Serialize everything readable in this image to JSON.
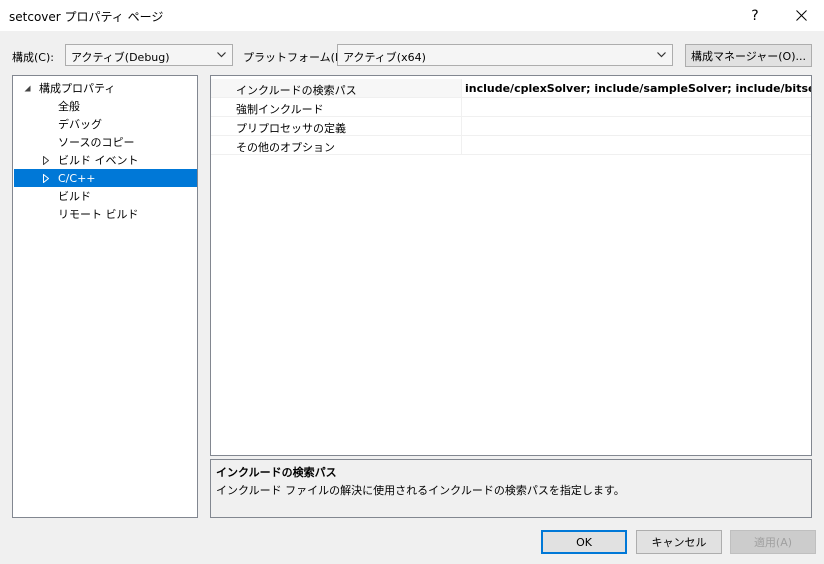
{
  "window": {
    "title": "setcover プロパティ ページ",
    "help_label": "?"
  },
  "toolbar": {
    "config_label": "構成(C):",
    "config_value": "アクティブ(Debug)",
    "platform_label": "プラットフォーム(P):",
    "platform_value": "アクティブ(x64)",
    "config_manager_label": "構成マネージャー(O)..."
  },
  "tree": {
    "items": [
      {
        "label": "構成プロパティ",
        "expander": "expanded"
      },
      {
        "label": "全般",
        "expander": "none"
      },
      {
        "label": "デバッグ",
        "expander": "none"
      },
      {
        "label": "ソースのコピー",
        "expander": "none"
      },
      {
        "label": "ビルド イベント",
        "expander": "collapsed"
      },
      {
        "label": "C/C++",
        "expander": "collapsed",
        "selected": true
      },
      {
        "label": "ビルド",
        "expander": "none"
      },
      {
        "label": "リモート ビルド",
        "expander": "none"
      }
    ]
  },
  "grid": {
    "rows": [
      {
        "name": "インクルードの検索パス",
        "value": "include/cplexSolver; include/sampleSolver; include/bitsetSolver;C"
      },
      {
        "name": "強制インクルード",
        "value": ""
      },
      {
        "name": "プリプロセッサの定義",
        "value": ""
      },
      {
        "name": "その他のオプション",
        "value": ""
      }
    ]
  },
  "description": {
    "title": "インクルードの検索パス",
    "text": "インクルード ファイルの解決に使用されるインクルードの検索パスを指定します。"
  },
  "buttons": {
    "ok": "OK",
    "cancel": "キャンセル",
    "apply": "適用(A)"
  }
}
